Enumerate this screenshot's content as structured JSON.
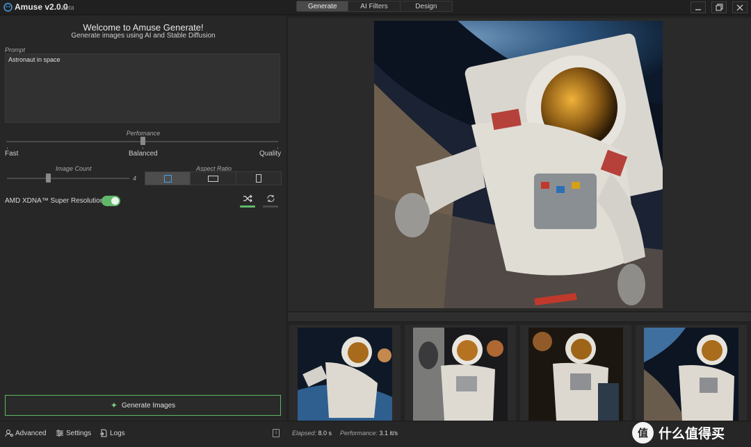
{
  "titlebar": {
    "app_name": "Amuse v2.0.0",
    "beta": "beta",
    "tabs": [
      {
        "label": "Generate",
        "active": true
      },
      {
        "label": "AI Filters",
        "active": false
      },
      {
        "label": "Design",
        "active": false
      }
    ],
    "window_buttons": [
      "minimize-icon",
      "restore-icon",
      "close-icon"
    ]
  },
  "left_panel": {
    "welcome_title": "Welcome to Amuse Generate!",
    "welcome_subtitle": "Generate images using AI and Stable Diffusion",
    "prompt_label": "Prompt",
    "prompt_value": "Astronaut in space",
    "performance": {
      "label": "Perfomance",
      "options": [
        "Fast",
        "Balanced",
        "Quality"
      ],
      "selected": "Balanced"
    },
    "image_count": {
      "label": "Image Count",
      "value": "4"
    },
    "aspect_ratio": {
      "label": "Aspect Ratio",
      "options": [
        "square",
        "landscape",
        "portrait"
      ],
      "selected": "square"
    },
    "super_resolution": {
      "label": "AMD XDNA™ Super Resolution",
      "enabled": true
    },
    "actions": {
      "shuffle_icon": "shuffle-icon",
      "loop_icon": "loop-icon"
    },
    "generate_button": "Generate Images"
  },
  "bottombar": {
    "advanced": "Advanced",
    "settings": "Settings",
    "logs": "Logs",
    "elapsed_label": "Elapsed:",
    "elapsed_value": "8.0 s",
    "performance_label": "Performance:",
    "performance_value": "3.1 it/s"
  },
  "watermark": {
    "circle": "值",
    "text": "什么值得买"
  },
  "colors": {
    "accent_green": "#62b86a",
    "accent_blue": "#4aa0e6",
    "bg": "#202020"
  }
}
